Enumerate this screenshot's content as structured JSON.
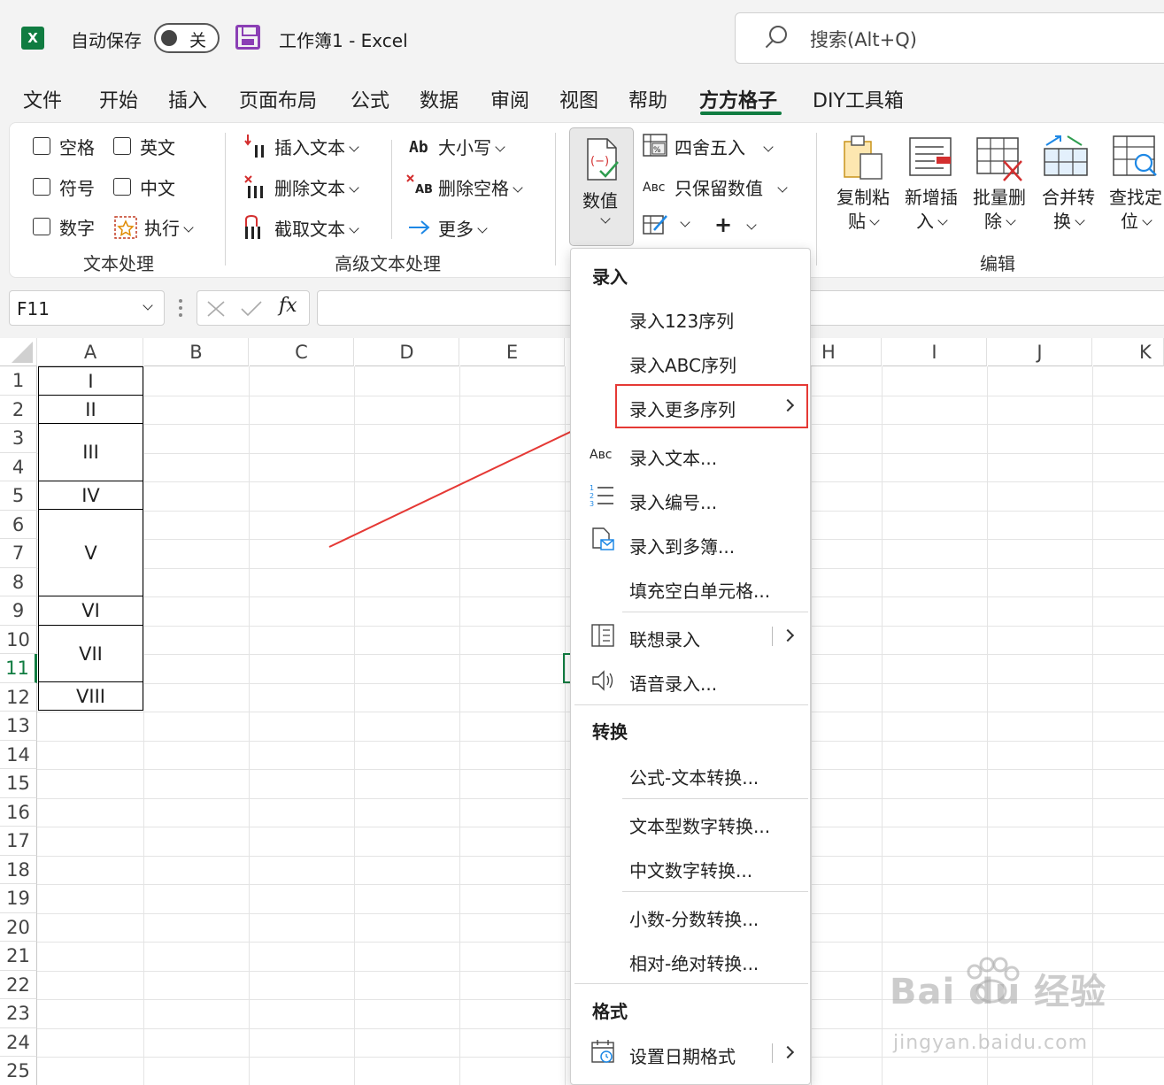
{
  "titlebar": {
    "autosave_label": "自动保存",
    "autosave_state": "关",
    "doc_title": "工作簿1  -  Excel",
    "search_placeholder": "搜索(Alt+Q)"
  },
  "tabs": [
    "文件",
    "开始",
    "插入",
    "页面布局",
    "公式",
    "数据",
    "审阅",
    "视图",
    "帮助",
    "方方格子",
    "DIY工具箱"
  ],
  "active_tab": "方方格子",
  "ribbon": {
    "text_group": {
      "label": "文本处理",
      "checkboxes": [
        "空格",
        "英文",
        "符号",
        "中文",
        "数字"
      ],
      "execute": "执行"
    },
    "advanced_group": {
      "label": "高级文本处理",
      "insert_text": "插入文本",
      "delete_text": "删除文本",
      "extract_text": "截取文本",
      "case": "大小写",
      "delete_space": "删除空格",
      "more": "更多"
    },
    "value_group": {
      "value_button": "数值",
      "round": "四舍五入",
      "keep_value": "只保留数值",
      "plus": "+"
    },
    "edit_group": {
      "label": "编辑",
      "copy_paste": [
        "复制粘",
        "贴"
      ],
      "insert_new": [
        "新增插",
        "入"
      ],
      "batch_delete": [
        "批量删",
        "除"
      ],
      "merge_convert": [
        "合并转",
        "换"
      ],
      "find_locate": [
        "查找定",
        "位"
      ]
    }
  },
  "formula_bar": {
    "name_box": "F11",
    "fx": "fx"
  },
  "columns": [
    "A",
    "B",
    "C",
    "D",
    "E",
    "H",
    "I",
    "J",
    "K"
  ],
  "rows": [
    "1",
    "2",
    "3",
    "4",
    "5",
    "6",
    "7",
    "8",
    "9",
    "10",
    "11",
    "12",
    "13",
    "14",
    "15",
    "16",
    "17",
    "18",
    "19",
    "20",
    "21",
    "22",
    "23",
    "24",
    "25"
  ],
  "cells_a": [
    "I",
    "II",
    "III",
    "IV",
    "V",
    "VI",
    "VII",
    "VIII"
  ],
  "dropdown": {
    "section_input": "录入",
    "items_input": [
      "录入123序列",
      "录入ABC序列",
      "录入更多序列",
      "录入文本...",
      "录入编号...",
      "录入到多簿...",
      "填充空白单元格...",
      "联想录入",
      "语音录入..."
    ],
    "section_convert": "转换",
    "items_convert": [
      "公式-文本转换...",
      "文本型数字转换...",
      "中文数字转换...",
      "小数-分数转换...",
      "相对-绝对转换..."
    ],
    "section_format": "格式",
    "items_format": [
      "设置日期格式"
    ]
  },
  "watermark": {
    "brand": "Bai du 经验",
    "url": "jingyan.baidu.com"
  },
  "colors": {
    "excel_green": "#107c41",
    "highlight_red": "#e53935",
    "save_purple": "#8b3fb5"
  }
}
